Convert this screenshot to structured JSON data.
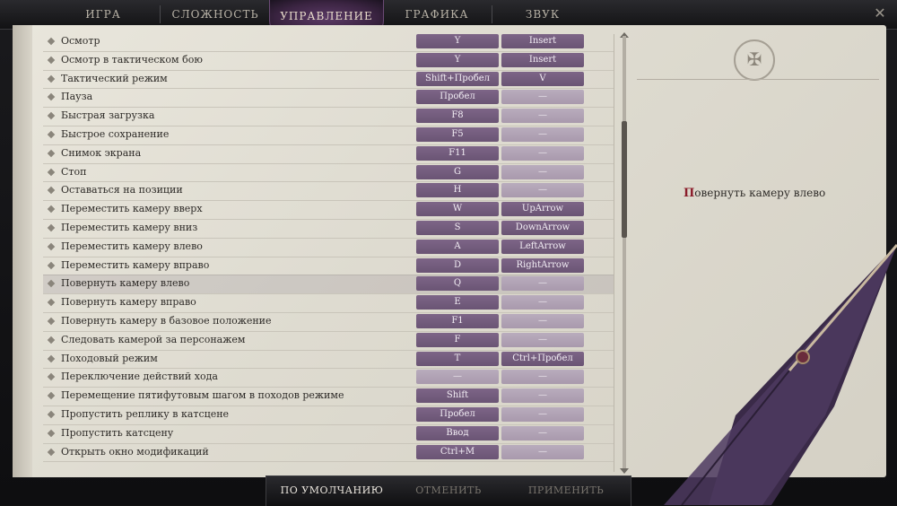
{
  "tabs": [
    {
      "label": "ИГРА",
      "active": false
    },
    {
      "label": "СЛОЖНОСТЬ",
      "active": false
    },
    {
      "label": "УПРАВЛЕНИЕ",
      "active": true
    },
    {
      "label": "ГРАФИКА",
      "active": false
    },
    {
      "label": "ЗВУК",
      "active": false
    }
  ],
  "close_icon": "close-icon",
  "bindings": [
    {
      "action": "Осмотр",
      "key1": "Y",
      "key2": "Insert"
    },
    {
      "action": "Осмотр в тактическом бою",
      "key1": "Y",
      "key2": "Insert"
    },
    {
      "action": "Тактический режим",
      "key1": "Shift+Пробел",
      "key2": "V"
    },
    {
      "action": "Пауза",
      "key1": "Пробел",
      "key2": "—"
    },
    {
      "action": "Быстрая загрузка",
      "key1": "F8",
      "key2": "—"
    },
    {
      "action": "Быстрое сохранение",
      "key1": "F5",
      "key2": "—"
    },
    {
      "action": "Снимок экрана",
      "key1": "F11",
      "key2": "—"
    },
    {
      "action": "Стоп",
      "key1": "G",
      "key2": "—"
    },
    {
      "action": "Оставаться на позиции",
      "key1": "H",
      "key2": "—"
    },
    {
      "action": "Переместить камеру вверх",
      "key1": "W",
      "key2": "UpArrow"
    },
    {
      "action": "Переместить камеру вниз",
      "key1": "S",
      "key2": "DownArrow"
    },
    {
      "action": "Переместить камеру влево",
      "key1": "A",
      "key2": "LeftArrow"
    },
    {
      "action": "Переместить камеру вправо",
      "key1": "D",
      "key2": "RightArrow"
    },
    {
      "action": "Повернуть камеру влево",
      "key1": "Q",
      "key2": "—"
    },
    {
      "action": "Повернуть камеру вправо",
      "key1": "E",
      "key2": "—"
    },
    {
      "action": "Повернуть камеру в базовое положение",
      "key1": "F1",
      "key2": "—"
    },
    {
      "action": "Следовать камерой за персонажем",
      "key1": "F",
      "key2": "—"
    },
    {
      "action": "Походовый режим",
      "key1": "T",
      "key2": "Ctrl+Пробел"
    },
    {
      "action": "Переключение действий хода",
      "key1": "—",
      "key2": "—"
    },
    {
      "action": "Перемещение пятифутовым шагом в походов режиме",
      "key1": "Shift",
      "key2": "—"
    },
    {
      "action": "Пропустить реплику в катсцене",
      "key1": "Пробел",
      "key2": "—"
    },
    {
      "action": "Пропустить катсцену",
      "key1": "Ввод",
      "key2": "—"
    },
    {
      "action": "Открыть окно модификаций",
      "key1": "Ctrl+M",
      "key2": "—"
    }
  ],
  "selected_index": 13,
  "description": {
    "title": "Повернуть камеру влево"
  },
  "buttons": {
    "default": "ПО УМОЛЧАНИЮ",
    "cancel": "ОТМЕНИТЬ",
    "apply": "ПРИМЕНИТЬ"
  },
  "colors": {
    "accent": "#6a5474",
    "parchment": "#e3e0d6",
    "drop_cap": "#8a1c2a"
  }
}
